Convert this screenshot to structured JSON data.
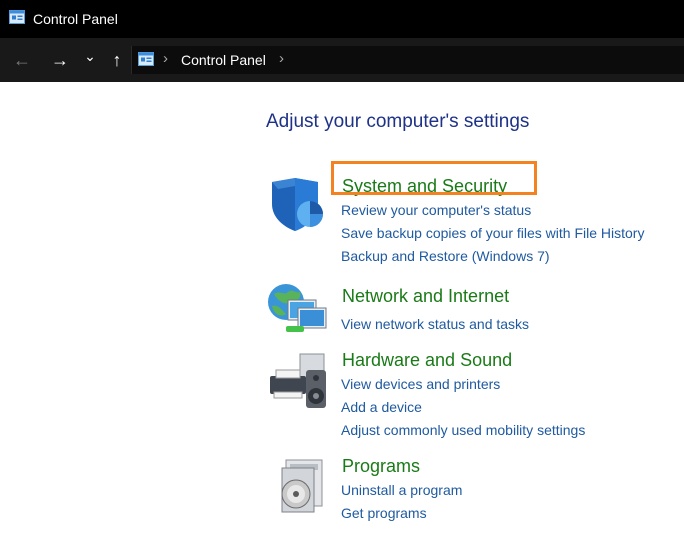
{
  "window": {
    "title": "Control Panel",
    "icon": "control-panel-icon"
  },
  "nav": {
    "back_glyph": "←",
    "forward_glyph": "→",
    "recent_glyph": "⌄",
    "up_glyph": "↑",
    "separator_glyph": "›",
    "breadcrumb": "Control Panel"
  },
  "main": {
    "heading": "Adjust your computer's settings",
    "categories": [
      {
        "title": "System and Security",
        "icon": "shield-icon",
        "links": [
          "Review your computer's status",
          "Save backup copies of your files with File History",
          "Backup and Restore (Windows 7)"
        ]
      },
      {
        "title": "Network and Internet",
        "icon": "network-globe-icon",
        "links": [
          "View network status and tasks"
        ]
      },
      {
        "title": "Hardware and Sound",
        "icon": "printer-speaker-icon",
        "links": [
          "View devices and printers",
          "Add a device",
          "Adjust commonly used mobility settings"
        ]
      },
      {
        "title": "Programs",
        "icon": "programs-disc-icon",
        "links": [
          "Uninstall a program",
          "Get programs"
        ]
      }
    ]
  },
  "colors": {
    "heading": "#1e3287",
    "category_title": "#1a7a17",
    "link": "#1f5aa0",
    "highlight": "#f58220",
    "titlebar": "#000000",
    "address_bar": "#191919"
  }
}
